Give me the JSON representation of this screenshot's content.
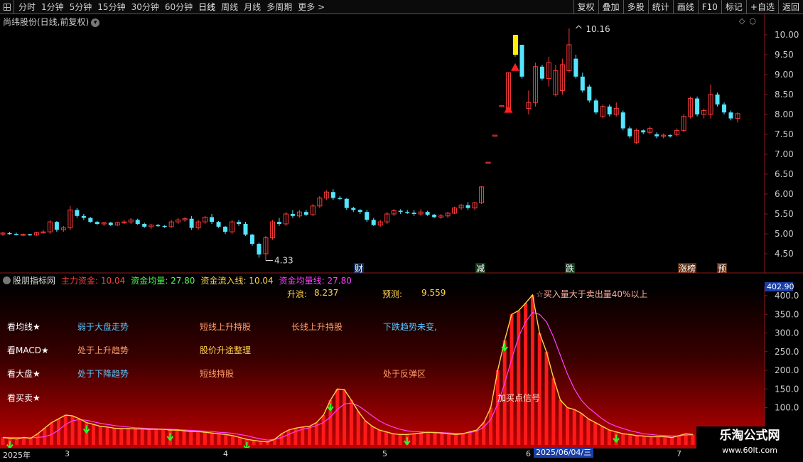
{
  "toolbar": {
    "timeframes": [
      "分时",
      "1分钟",
      "5分钟",
      "15分钟",
      "30分钟",
      "60分钟",
      "日线",
      "周线",
      "月线",
      "多周期",
      "更多 >"
    ],
    "tools": [
      "复权",
      "叠加",
      "多股",
      "统计",
      "画线",
      "F10",
      "标记",
      "+自选",
      "返回"
    ]
  },
  "stock": {
    "title": "尚纬股份(日线,前复权)",
    "high_label": "10.16",
    "low_label": "4.33"
  },
  "price_axis": [
    "10.00",
    "9.50",
    "9.00",
    "8.50",
    "8.00",
    "7.50",
    "7.00",
    "6.50",
    "6.00",
    "5.50",
    "5.00",
    "4.50"
  ],
  "event_markers": [
    "财",
    "减",
    "跌",
    "涨榜",
    "预"
  ],
  "indicator": {
    "name": "股朋指标网",
    "fields": [
      {
        "label": "主力资金: 10.04"
      },
      {
        "label": "资金均量: 27.80"
      },
      {
        "label": "资金流入线: 10.04"
      },
      {
        "label": "资金均量线: 27.80"
      }
    ],
    "rise_label": "升浪:",
    "rise_value": "8.237",
    "forecast_label": "预测:",
    "forecast_value": "9.559",
    "buy_note": "☆买入量大于卖出量40%以上",
    "buy_signal": "加买点信号",
    "current_value": "402.90",
    "axis": [
      "400.0",
      "350.0",
      "300.0",
      "250.0",
      "200.0",
      "150.0",
      "100.0"
    ]
  },
  "rows": [
    {
      "label": "看均线★",
      "cells": [
        "弱于大盘走势",
        "短线上升持股",
        "长线上升持股",
        "下跌趋势未变,"
      ]
    },
    {
      "label": "看MACD★",
      "cells": [
        "处于上升趋势",
        "股价升途整理"
      ]
    },
    {
      "label": "看大盘★",
      "cells": [
        "处于下降趋势",
        "短线持股",
        "处于反弹区"
      ]
    },
    {
      "label": "看买卖★"
    }
  ],
  "date_axis": {
    "labels": [
      "2025年",
      "3",
      "4",
      "5",
      "6",
      "7"
    ],
    "highlight": "2025/06/04/三"
  },
  "watermark": {
    "title": "乐淘公式网",
    "url": "www.60lt.com"
  },
  "colors": {
    "up": "#ff3b3b",
    "down": "#54e5ff",
    "fund_line": "#ffd24a",
    "avg_line": "#ff40ff",
    "arrow": "#2bff2b",
    "axis": "#8b1a1a"
  },
  "chart_data": [
    {
      "type": "candlestick",
      "title": "尚纬股份(日线,前复权)",
      "ylim": [
        4.2,
        10.3
      ],
      "x": [
        "2025-02",
        "2025-03",
        "2025-04",
        "2025-05",
        "2025-06",
        "2025-07"
      ],
      "ohlc": [
        [
          5.0,
          5.05,
          4.95,
          5.02
        ],
        [
          5.02,
          5.05,
          4.98,
          5.0
        ],
        [
          5.0,
          5.03,
          4.96,
          4.98
        ],
        [
          4.98,
          5.01,
          4.94,
          4.99
        ],
        [
          4.99,
          5.0,
          4.95,
          4.97
        ],
        [
          4.97,
          5.05,
          4.95,
          5.03
        ],
        [
          5.03,
          5.1,
          5.0,
          5.05
        ],
        [
          5.05,
          5.35,
          5.0,
          5.3
        ],
        [
          5.3,
          5.32,
          5.05,
          5.1
        ],
        [
          5.1,
          5.2,
          5.05,
          5.15
        ],
        [
          5.15,
          5.7,
          5.1,
          5.6
        ],
        [
          5.6,
          5.65,
          5.4,
          5.45
        ],
        [
          5.45,
          5.5,
          5.35,
          5.4
        ],
        [
          5.4,
          5.42,
          5.28,
          5.3
        ],
        [
          5.3,
          5.32,
          5.22,
          5.25
        ],
        [
          5.25,
          5.3,
          5.2,
          5.28
        ],
        [
          5.28,
          5.3,
          5.2,
          5.22
        ],
        [
          5.22,
          5.3,
          5.2,
          5.28
        ],
        [
          5.28,
          5.35,
          5.25,
          5.3
        ],
        [
          5.3,
          5.4,
          5.25,
          5.35
        ],
        [
          5.35,
          5.38,
          5.22,
          5.25
        ],
        [
          5.25,
          5.28,
          5.15,
          5.18
        ],
        [
          5.18,
          5.25,
          5.12,
          5.22
        ],
        [
          5.22,
          5.25,
          5.18,
          5.2
        ],
        [
          5.2,
          5.22,
          5.15,
          5.18
        ],
        [
          5.18,
          5.35,
          5.15,
          5.3
        ],
        [
          5.3,
          5.4,
          5.25,
          5.35
        ],
        [
          5.35,
          5.42,
          5.3,
          5.38
        ],
        [
          5.38,
          5.45,
          5.1,
          5.15
        ],
        [
          5.15,
          5.35,
          5.1,
          5.3
        ],
        [
          5.3,
          5.45,
          5.25,
          5.42
        ],
        [
          5.42,
          5.5,
          5.25,
          5.3
        ],
        [
          5.3,
          5.32,
          5.15,
          5.18
        ],
        [
          5.18,
          5.2,
          5.0,
          5.05
        ],
        [
          5.05,
          5.35,
          5.0,
          5.3
        ],
        [
          5.3,
          5.35,
          5.2,
          5.25
        ],
        [
          5.25,
          5.3,
          4.95,
          4.98
        ],
        [
          4.98,
          5.0,
          4.7,
          4.75
        ],
        [
          4.75,
          4.78,
          4.4,
          4.48
        ],
        [
          4.5,
          4.95,
          4.33,
          4.9
        ],
        [
          4.9,
          5.35,
          4.85,
          5.3
        ],
        [
          5.3,
          5.4,
          5.2,
          5.25
        ],
        [
          5.25,
          5.55,
          5.2,
          5.5
        ],
        [
          5.5,
          5.6,
          5.4,
          5.45
        ],
        [
          5.45,
          5.6,
          5.4,
          5.55
        ],
        [
          5.55,
          5.6,
          5.45,
          5.48
        ],
        [
          5.48,
          5.75,
          5.45,
          5.7
        ],
        [
          5.7,
          5.95,
          5.65,
          5.9
        ],
        [
          5.9,
          6.1,
          5.85,
          6.05
        ],
        [
          6.05,
          6.12,
          5.85,
          5.9
        ],
        [
          5.9,
          5.95,
          5.85,
          5.88
        ],
        [
          5.88,
          5.9,
          5.6,
          5.65
        ],
        [
          5.65,
          5.68,
          5.55,
          5.6
        ],
        [
          5.6,
          5.62,
          5.5,
          5.55
        ],
        [
          5.55,
          5.6,
          5.3,
          5.35
        ],
        [
          5.35,
          5.4,
          5.2,
          5.22
        ],
        [
          5.22,
          5.35,
          5.18,
          5.3
        ],
        [
          5.3,
          5.55,
          5.25,
          5.5
        ],
        [
          5.5,
          5.62,
          5.45,
          5.58
        ],
        [
          5.58,
          5.62,
          5.5,
          5.55
        ],
        [
          5.55,
          5.6,
          5.5,
          5.53
        ],
        [
          5.53,
          5.6,
          5.45,
          5.5
        ],
        [
          5.5,
          5.62,
          5.45,
          5.55
        ],
        [
          5.55,
          5.58,
          5.45,
          5.48
        ],
        [
          5.48,
          5.5,
          5.4,
          5.42
        ],
        [
          5.42,
          5.5,
          5.38,
          5.45
        ],
        [
          5.45,
          5.55,
          5.4,
          5.52
        ],
        [
          5.52,
          5.68,
          5.5,
          5.65
        ],
        [
          5.65,
          5.75,
          5.6,
          5.72
        ],
        [
          5.72,
          5.8,
          5.6,
          5.65
        ],
        [
          5.65,
          5.8,
          5.6,
          5.78
        ],
        [
          5.78,
          6.2,
          5.75,
          6.18
        ],
        [
          6.8,
          6.8,
          6.8,
          6.8
        ],
        [
          7.48,
          7.48,
          7.48,
          7.48
        ],
        [
          8.22,
          8.22,
          8.22,
          8.22
        ],
        [
          8.1,
          9.05,
          8.05,
          9.05
        ],
        [
          9.95,
          9.95,
          9.45,
          9.5
        ],
        [
          9.75,
          9.75,
          8.9,
          8.95
        ],
        [
          8.15,
          8.6,
          8.0,
          8.3
        ],
        [
          8.3,
          9.3,
          8.2,
          9.2
        ],
        [
          9.2,
          9.25,
          8.85,
          8.9
        ],
        [
          8.9,
          9.45,
          8.7,
          9.3
        ],
        [
          8.5,
          9.25,
          8.45,
          9.1
        ],
        [
          8.6,
          9.4,
          8.5,
          9.25
        ],
        [
          9.1,
          10.16,
          9.05,
          9.75
        ],
        [
          9.4,
          9.5,
          8.9,
          8.95
        ],
        [
          8.95,
          9.05,
          8.55,
          8.6
        ],
        [
          8.7,
          8.75,
          8.3,
          8.35
        ],
        [
          8.35,
          8.4,
          8.0,
          8.05
        ],
        [
          7.95,
          8.25,
          7.9,
          8.2
        ],
        [
          8.2,
          8.25,
          7.95,
          8.0
        ],
        [
          8.0,
          8.3,
          7.95,
          8.15
        ],
        [
          8.05,
          8.1,
          7.6,
          7.65
        ],
        [
          7.65,
          7.7,
          7.4,
          7.45
        ],
        [
          7.3,
          7.65,
          7.25,
          7.6
        ],
        [
          7.6,
          7.62,
          7.5,
          7.55
        ],
        [
          7.55,
          7.7,
          7.5,
          7.65
        ],
        [
          7.5,
          7.55,
          7.4,
          7.45
        ],
        [
          7.45,
          7.52,
          7.4,
          7.48
        ],
        [
          7.48,
          7.5,
          7.42,
          7.45
        ],
        [
          7.5,
          7.65,
          7.45,
          7.6
        ],
        [
          7.6,
          8.0,
          7.55,
          7.95
        ],
        [
          7.95,
          8.45,
          7.9,
          8.4
        ],
        [
          8.4,
          8.45,
          7.95,
          8.0
        ],
        [
          8.0,
          8.15,
          7.9,
          8.1
        ],
        [
          8.0,
          8.75,
          7.9,
          8.5
        ],
        [
          8.5,
          8.55,
          8.2,
          8.25
        ],
        [
          8.25,
          8.3,
          8.0,
          8.05
        ],
        [
          8.05,
          8.1,
          7.85,
          7.9
        ],
        [
          7.9,
          8.05,
          7.8,
          8.02
        ]
      ]
    },
    {
      "type": "bar",
      "title": "股朋指标网",
      "ylim": [
        0,
        420
      ],
      "series": [
        {
          "name": "主力资金",
          "values": [
            20,
            18,
            16,
            20,
            18,
            30,
            45,
            60,
            70,
            80,
            78,
            70,
            60,
            55,
            50,
            48,
            45,
            44,
            44,
            43,
            43,
            42,
            42,
            42,
            40,
            40,
            38,
            36,
            36,
            34,
            32,
            30,
            28,
            25,
            20,
            15,
            12,
            10,
            8,
            15,
            30,
            40,
            45,
            48,
            50,
            60,
            80,
            120,
            150,
            148,
            120,
            90,
            65,
            50,
            40,
            35,
            30,
            28,
            28,
            30,
            32,
            34,
            33,
            32,
            30,
            28,
            30,
            35,
            40,
            60,
            100,
            200,
            280,
            350,
            360,
            380,
            402,
            300,
            250,
            180,
            120,
            100,
            95,
            85,
            70,
            60,
            50,
            40,
            35,
            30,
            28,
            25,
            24,
            22,
            22,
            22,
            20,
            25,
            30,
            28
          ]
        },
        {
          "name": "资金均量",
          "values": [
            20,
            20,
            20,
            19,
            19,
            20,
            22,
            28,
            40,
            55,
            65,
            68,
            66,
            62,
            58,
            55,
            52,
            50,
            48,
            46,
            45,
            44,
            43,
            42,
            42,
            41,
            40,
            39,
            38,
            37,
            36,
            34,
            33,
            31,
            28,
            25,
            20,
            16,
            13,
            15,
            20,
            28,
            36,
            42,
            46,
            52,
            60,
            75,
            95,
            110,
            112,
            105,
            92,
            78,
            65,
            55,
            48,
            42,
            38,
            36,
            35,
            34,
            34,
            33,
            32,
            31,
            31,
            33,
            37,
            48,
            68,
            110,
            165,
            230,
            290,
            330,
            355,
            350,
            330,
            290,
            240,
            190,
            150,
            120,
            100,
            85,
            70,
            58,
            50,
            44,
            38,
            34,
            30,
            28,
            26,
            25,
            24,
            24,
            26,
            27
          ]
        }
      ]
    }
  ]
}
